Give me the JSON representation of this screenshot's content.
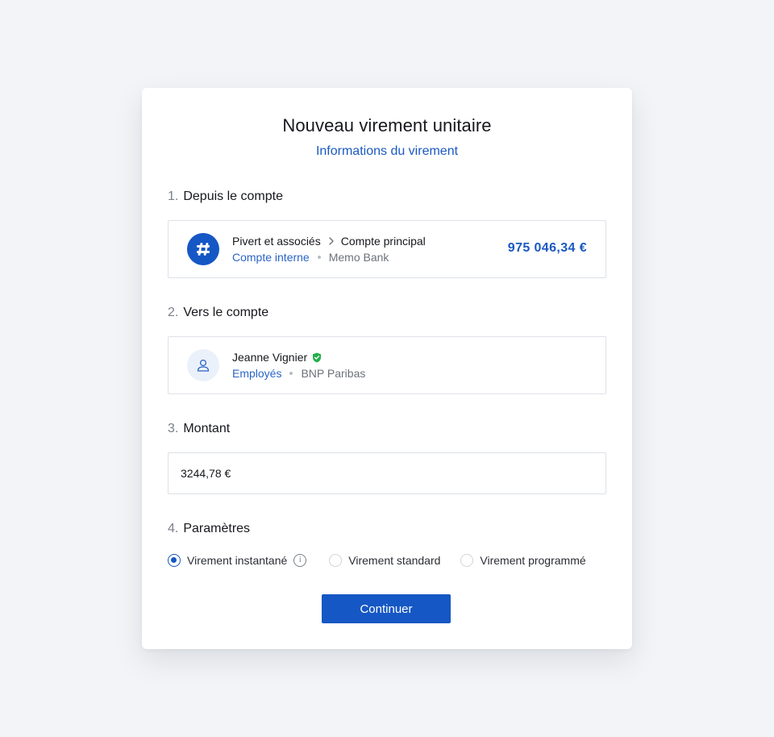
{
  "dialog": {
    "title": "Nouveau virement unitaire",
    "subtitle": "Informations du virement"
  },
  "sections": {
    "from": {
      "number": "1.",
      "title": "Depuis le compte"
    },
    "to": {
      "number": "2.",
      "title": "Vers le compte"
    },
    "amount": {
      "number": "3.",
      "title": "Montant"
    },
    "params": {
      "number": "4.",
      "title": "Paramètres"
    }
  },
  "from_account": {
    "holder": "Pivert et associés",
    "account_name": "Compte principal",
    "type": "Compte interne",
    "bank": "Memo Bank",
    "balance": "975 046,34 €",
    "icon": "brand-logo-icon",
    "brand_color": "#1557c4"
  },
  "to_account": {
    "name": "Jeanne Vignier",
    "verified": true,
    "group": "Employés",
    "bank": "BNP Paribas",
    "icon": "user-icon",
    "verified_color": "#22b04b"
  },
  "amount": {
    "value": "3244,78 €"
  },
  "transfer_types": {
    "selected": "instant",
    "options": [
      {
        "id": "instant",
        "label": "Virement instantané",
        "has_info": true
      },
      {
        "id": "standard",
        "label": "Virement standard"
      },
      {
        "id": "scheduled",
        "label": "Virement programmé"
      }
    ]
  },
  "actions": {
    "continue_label": "Continuer"
  }
}
